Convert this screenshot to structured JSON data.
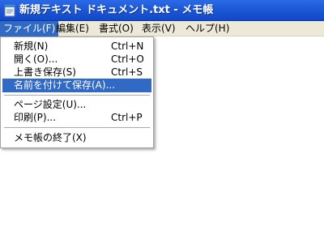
{
  "window": {
    "title": "新規テキスト ドキュメント.txt - メモ帳"
  },
  "menubar": {
    "items": [
      {
        "label": "ファイル(F)"
      },
      {
        "label": "編集(E)"
      },
      {
        "label": "書式(O)"
      },
      {
        "label": "表示(V)"
      },
      {
        "label": "ヘルプ(H)"
      }
    ],
    "active_index": 0
  },
  "file_menu": {
    "items": [
      {
        "label": "新規(N)",
        "shortcut": "Ctrl+N"
      },
      {
        "label": "開く(O)...",
        "shortcut": "Ctrl+O"
      },
      {
        "label": "上書き保存(S)",
        "shortcut": "Ctrl+S"
      },
      {
        "label": "名前を付けて保存(A)...",
        "shortcut": ""
      },
      {
        "label": "ページ設定(U)...",
        "shortcut": ""
      },
      {
        "label": "印刷(P)...",
        "shortcut": "Ctrl+P"
      },
      {
        "label": "メモ帳の終了(X)",
        "shortcut": ""
      }
    ],
    "highlighted_index": 3
  },
  "colors": {
    "titlebar": "#1f5ad7",
    "menubar": "#ece9d8",
    "highlight": "#316ac5"
  },
  "icons": {
    "app": "notepad-icon"
  }
}
